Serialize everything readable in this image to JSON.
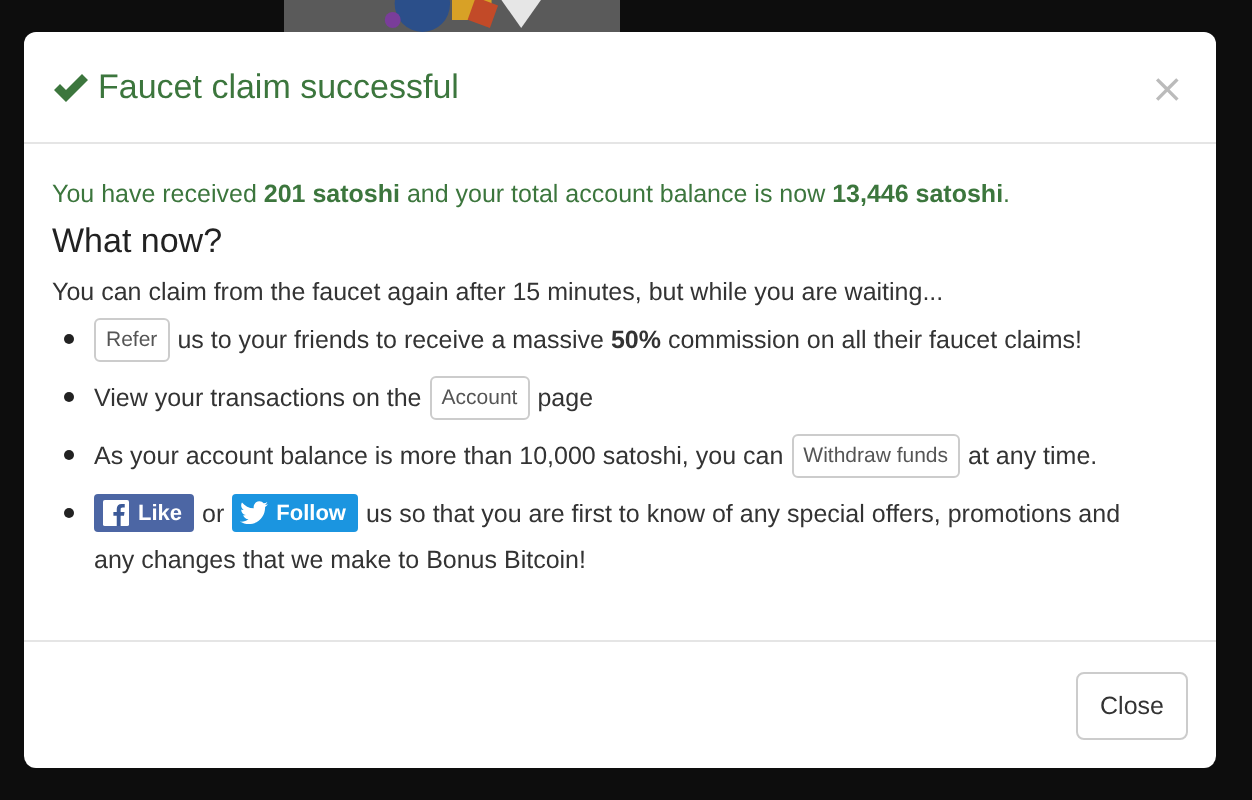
{
  "modal": {
    "title": "Faucet claim successful",
    "close": "×",
    "message": "You have received **201 satoshi** and your total account balance is now **13,446 satoshi**.",
    "heading": "What now?",
    "intro": "You can claim from the faucet again after 15 minutes, but while you are waiting...",
    "items": [
      {
        "parts": [
          {
            "kind": "button",
            "text": "Refer"
          },
          {
            "kind": "text",
            "text": "us to your friends to receive a massive **50%** commission on all their faucet claims!"
          }
        ]
      },
      {
        "parts": [
          {
            "kind": "text",
            "text": "View your transactions on the"
          },
          {
            "kind": "button",
            "text": "Account"
          },
          {
            "kind": "text",
            "text": "page"
          }
        ]
      },
      {
        "parts": [
          {
            "kind": "text",
            "text": "As your account balance is more than 10,000 satoshi, you can"
          },
          {
            "kind": "button",
            "text": "Withdraw funds"
          },
          {
            "kind": "text",
            "text": "at any time."
          }
        ]
      },
      {
        "parts": [
          {
            "kind": "facebook",
            "text": "Like"
          },
          {
            "kind": "text",
            "text": "or"
          },
          {
            "kind": "twitter",
            "text": "Follow"
          },
          {
            "kind": "text",
            "text": "us so that you are first to know of any special offers, promotions and"
          },
          {
            "kind": "break"
          },
          {
            "kind": "text",
            "text": "any changes that we make to Bonus Bitcoin!"
          }
        ]
      }
    ],
    "footer_button": "Close"
  }
}
